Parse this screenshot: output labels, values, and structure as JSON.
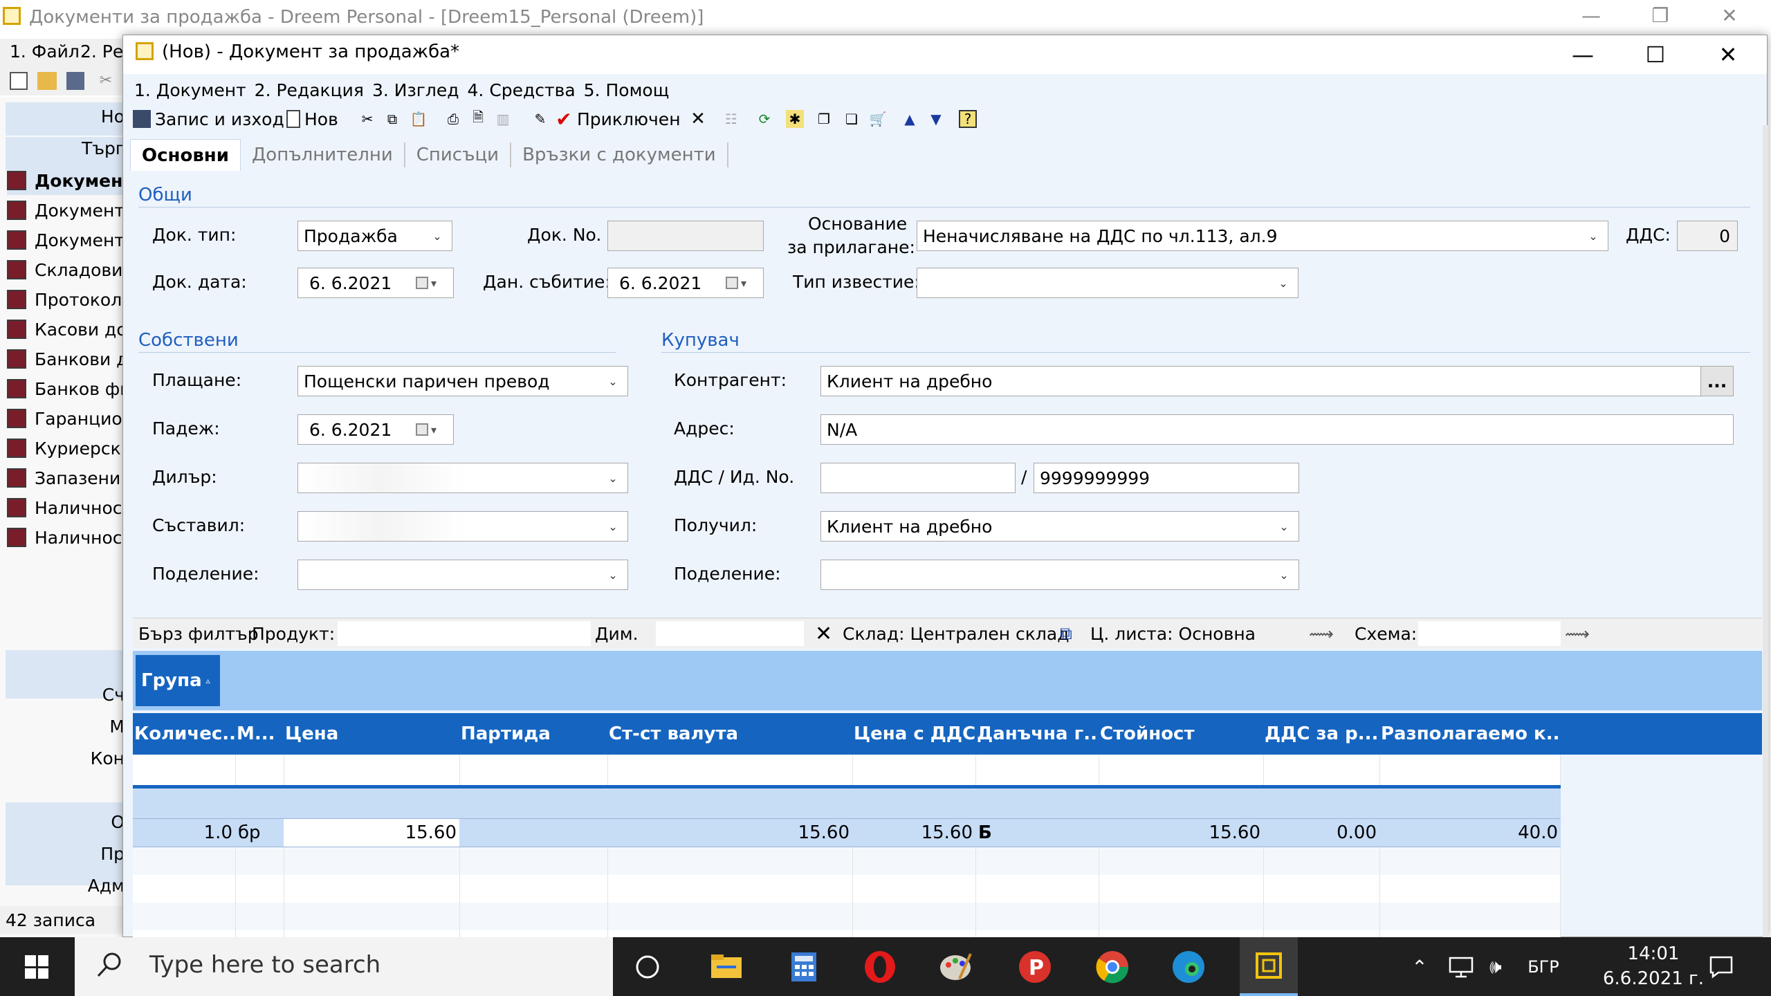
{
  "bg_window": {
    "title": "Документи за продажба - Dreem Personal - [Dreem15_Personal (Dreem)]",
    "menu": [
      "1. Файл",
      "2. Ре"
    ],
    "sidebar_right_labels": [
      "Но",
      "Търг",
      "Сч",
      "М",
      "Кон",
      "О",
      "Пр",
      "Адм"
    ],
    "sidebar_items": [
      "Докумен",
      "Документ",
      "Документ",
      "Складови",
      "Протокол",
      "Касови до",
      "Банкови д",
      "Банков фи",
      "Гаранцио",
      "Куриерск",
      "Запазени",
      "Наличнос",
      "Наличнос"
    ],
    "status": "42 записа"
  },
  "dialog": {
    "title": "(Нов) - Документ за продажба*",
    "menu": [
      "1. Документ",
      "2. Редакция",
      "3. Изглед",
      "4. Средства",
      "5. Помощ"
    ],
    "toolbar": {
      "save_exit": "Запис и изход",
      "new": "Нов",
      "complete": "Приключен"
    },
    "tabs": [
      "Основни",
      "Допълнителни",
      "Списъци",
      "Връзки с документи"
    ],
    "general": {
      "title": "Общи",
      "doc_type_label": "Док. тип:",
      "doc_type_value": "Продажба",
      "doc_no_label": "Док. No.",
      "doc_no_value": "",
      "basis_label_1": "Основание",
      "basis_label_2": "за прилагане:",
      "basis_value": "Неначисляване на ДДС по чл.113, ал.9",
      "vat_label": "ДДС:",
      "vat_value": "0",
      "doc_date_label": "Док. дата:",
      "doc_date_value": "6.  6.2021",
      "tax_event_label": "Дан. събитие:",
      "tax_event_value": "6.  6.2021",
      "notice_type_label": "Тип известие:",
      "notice_type_value": ""
    },
    "own": {
      "title": "Собствени",
      "payment_label": "Плащане:",
      "payment_value": "Пощенски паричен превод",
      "due_label": "Падеж:",
      "due_value": "6.  6.2021",
      "dealer_label": "Дилър:",
      "composed_label": "Съставил:",
      "division_label": "Поделение:",
      "division_value": ""
    },
    "buyer": {
      "title": "Купувач",
      "partner_label": "Контрагент:",
      "partner_value": "Клиент на дребно",
      "partner_button": "...",
      "address_label": "Адрес:",
      "address_value": "N/A",
      "vat_id_label": "ДДС / Ид. No.",
      "vat_no_value": "",
      "slash": "/",
      "id_no_value": "9999999999",
      "received_label": "Получил:",
      "received_value": "Клиент на дребно",
      "division_label": "Поделение:",
      "division_value": ""
    },
    "filter": {
      "quick_filter": "Бърз филтър",
      "product_label": "Продукт:",
      "dim_label": "Дим.",
      "warehouse": "Склад: Централен склад",
      "price_list": "Ц. листа: Основна",
      "scheme_label": "Схема:"
    },
    "grid": {
      "group_button": "Група",
      "columns": [
        "Количес...",
        "М...",
        "Цена",
        "Партида",
        "Ст-ст валута",
        "Цена с ДДС",
        "Данъчна г...",
        "Стойност",
        "ДДС за р...",
        "Разполагаемо к..."
      ],
      "row": {
        "qty": "1.0",
        "unit": "бр",
        "price": "15.60",
        "batch": "",
        "cost_currency": "15.60",
        "price_vat": "15.60",
        "tax_group": "Б",
        "value": "15.60",
        "vat_amount": "0.00",
        "available": "40.0"
      }
    }
  },
  "taskbar": {
    "search_placeholder": "Type here to search",
    "language": "БГР",
    "time": "14:01",
    "date": "6.6.2021 г."
  },
  "colors": {
    "accent": "#1565c0",
    "group_band": "#9ec9f5",
    "section_title": "#1f5fbf",
    "dialog_bg": "#eef4fc"
  }
}
